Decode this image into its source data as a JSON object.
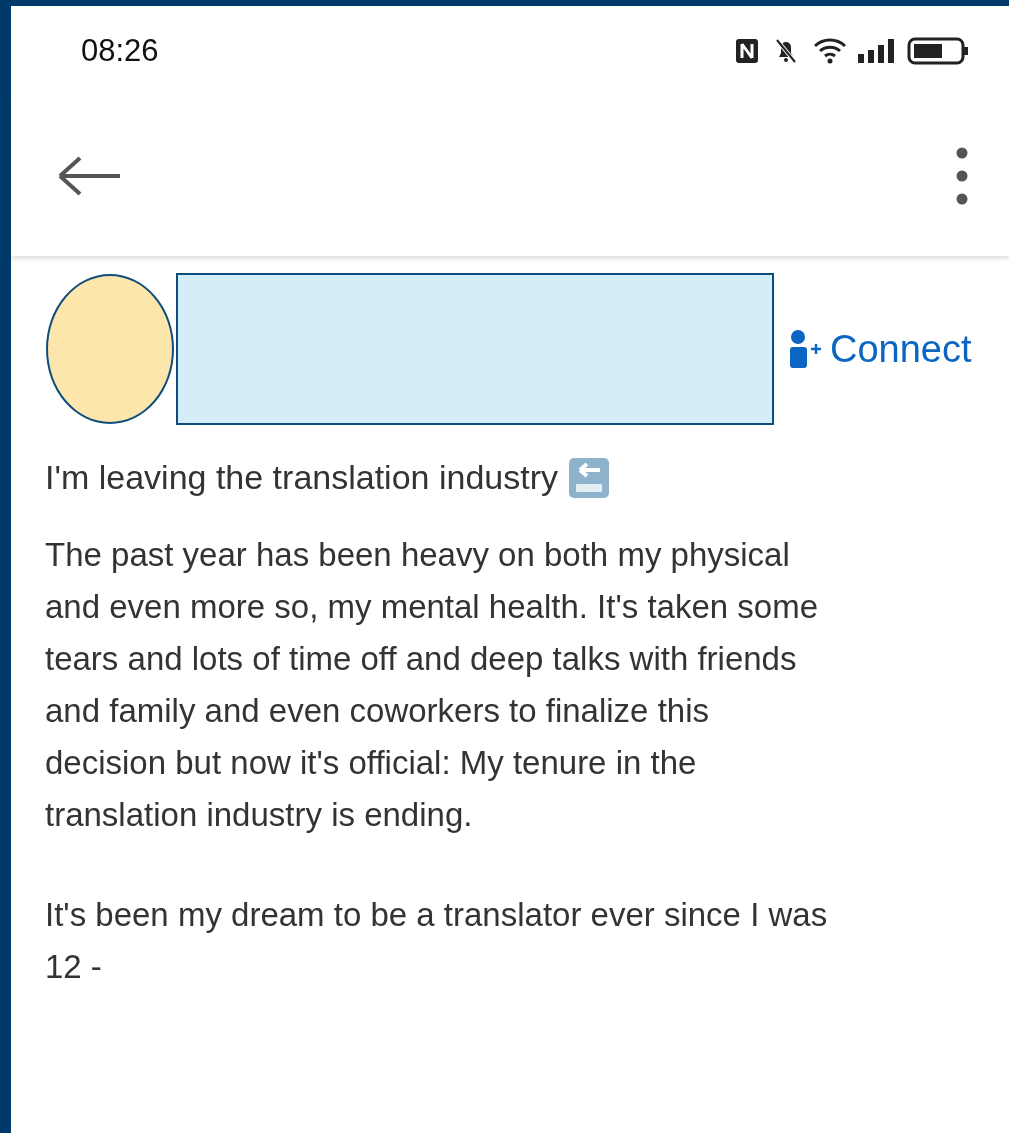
{
  "status_bar": {
    "time": "08:26"
  },
  "post": {
    "connect": "Connect",
    "headline": "I'm leaving the translation industry",
    "paragraphs": [
      {
        "lines": [
          "The past year has been heavy on both my physical",
          "and even more so, my mental health. It's taken some",
          "tears and lots of time off and deep talks with friends",
          "and family and even coworkers to finalize this",
          "decision but now it's official: My tenure in the",
          "translation industry is ending."
        ]
      },
      {
        "lines": [
          "It's been my dream to be a translator ever since I was",
          "12 -"
        ]
      }
    ]
  }
}
